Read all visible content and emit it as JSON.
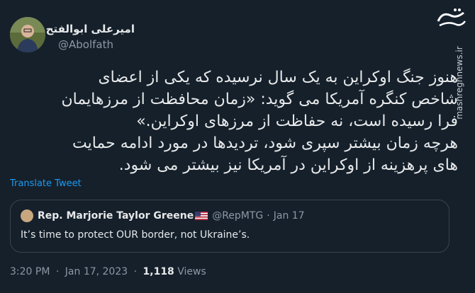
{
  "author": {
    "name": "امیرعلی ابوالفتح",
    "handle": "@Abolfath"
  },
  "tweet": {
    "lines": [
      "هنوز جنگ اوکراین به یک سال نرسیده که یکی از اعضای",
      "شاخص کنگره آمریکا می گوید: «زمان محافظت از مرزهایمان",
      "فرا رسیده است، نه حفاظت از مرزهای اوکراین.»",
      "هرچه زمان بیشتر سپری شود، تردیدها در مورد ادامه حمایت",
      "های پرهزینه از اوکراین در آمریکا نیز بیشتر می شود."
    ]
  },
  "translate_label": "Translate Tweet",
  "quote": {
    "name": "Rep. Marjorie Taylor Greene",
    "handle": "@RepMTG",
    "separator": "·",
    "date": "Jan 17",
    "text": "It’s time to protect OUR border, not Ukraine’s."
  },
  "footer": {
    "time": "3:20 PM",
    "sep1": "·",
    "date": "Jan 17, 2023",
    "sep2": "·",
    "views_count": "1,118",
    "views_label": "Views"
  },
  "watermark": "mashreghnews.ir",
  "colors": {
    "background": "#15202b",
    "link": "#1d9bf0",
    "muted": "#8b98a5",
    "border": "#38444d"
  }
}
